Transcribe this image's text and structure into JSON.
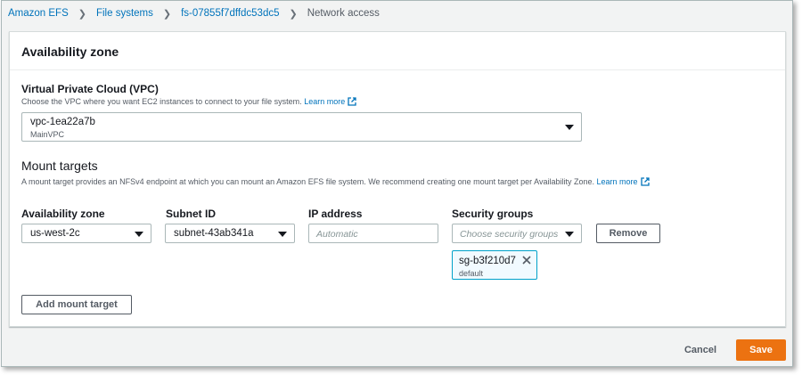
{
  "breadcrumb": {
    "items": [
      "Amazon EFS",
      "File systems",
      "fs-07855f7dffdc53dc5"
    ],
    "current": "Network access"
  },
  "panel": {
    "title": "Availability zone"
  },
  "vpc": {
    "label": "Virtual Private Cloud (VPC)",
    "description": "Choose the VPC where you want EC2 instances to connect to your file system.",
    "learn_more": "Learn more",
    "selected_value": "vpc-1ea22a7b",
    "selected_name": "MainVPC"
  },
  "mount_targets": {
    "title": "Mount targets",
    "description": "A mount target provides an NFSv4 endpoint at which you can mount an Amazon EFS file system. We recommend creating one mount target per Availability Zone.",
    "learn_more": "Learn more",
    "columns": {
      "availability_zone": "Availability zone",
      "subnet_id": "Subnet ID",
      "ip_address": "IP address",
      "security_groups": "Security groups"
    },
    "row": {
      "availability_zone": "us-west-2c",
      "subnet_id": "subnet-43ab341a",
      "ip_placeholder": "Automatic",
      "security_groups_placeholder": "Choose security groups",
      "remove_label": "Remove",
      "token": {
        "name": "sg-b3f210d7",
        "description": "default"
      }
    },
    "add_label": "Add mount target"
  },
  "footer": {
    "cancel_label": "Cancel",
    "save_label": "Save"
  },
  "colors": {
    "link": "#0073bb",
    "primary_button": "#ec7211",
    "token_border": "#00a1c9"
  }
}
